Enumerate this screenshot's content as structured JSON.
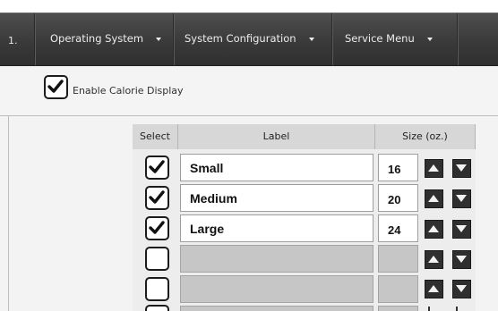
{
  "nav": {
    "stub_label": "1.",
    "menus": [
      {
        "label": "Operating System"
      },
      {
        "label": "System Configuration"
      },
      {
        "label": "Service Menu"
      }
    ]
  },
  "settings": {
    "calorie_label": "Enable Calorie Display",
    "calorie_checked": true
  },
  "table": {
    "headers": {
      "select": "Select",
      "label": "Label",
      "size": "Size (oz.)"
    },
    "rows": [
      {
        "checked": true,
        "label": "Small",
        "size": "16",
        "editable": true
      },
      {
        "checked": true,
        "label": "Medium",
        "size": "20",
        "editable": true
      },
      {
        "checked": true,
        "label": "Large",
        "size": "24",
        "editable": true
      },
      {
        "checked": false,
        "label": "",
        "size": "",
        "editable": false
      },
      {
        "checked": false,
        "label": "",
        "size": "",
        "editable": false
      }
    ]
  },
  "colors": {
    "nav_bg": "#3d3d3d",
    "header_bg": "#d7d7d7",
    "disabled_cell": "#c6c6c6",
    "arrow_button": "#2f2f2f"
  }
}
